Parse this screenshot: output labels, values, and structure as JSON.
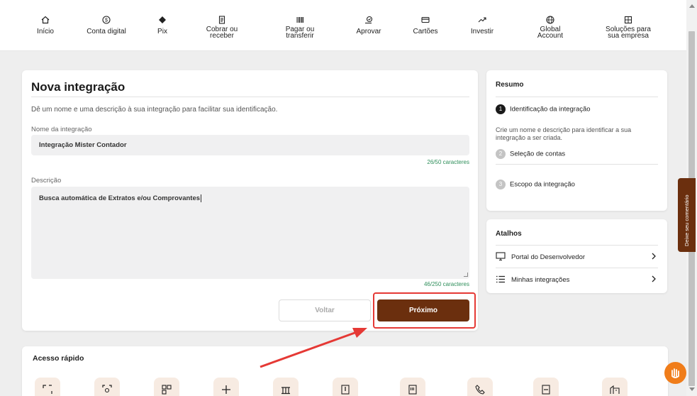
{
  "nav": {
    "items": [
      {
        "label": "Início",
        "icon": "home-icon"
      },
      {
        "label": "Conta digital",
        "icon": "dollar-coin-icon"
      },
      {
        "label": "Pix",
        "icon": "pix-icon"
      },
      {
        "label1": "Cobrar ou",
        "label2": "receber",
        "icon": "invoice-icon"
      },
      {
        "label1": "Pagar ou",
        "label2": "transferir",
        "icon": "barcode-icon"
      },
      {
        "label": "Aprovar",
        "icon": "approve-icon"
      },
      {
        "label": "Cartões",
        "icon": "card-icon"
      },
      {
        "label": "Investir",
        "icon": "trend-icon"
      },
      {
        "label1": "Global",
        "label2": "Account",
        "icon": "globe-icon"
      },
      {
        "label1": "Soluções para",
        "label2": "sua empresa",
        "icon": "building-icon"
      }
    ]
  },
  "main": {
    "title": "Nova integração",
    "subtitle": "Dê um nome e uma descrição à sua integração para facilitar sua identificação.",
    "name_label": "Nome da integração",
    "name_value": "Integração Mister Contador",
    "name_counter": "26/50 caracteres",
    "desc_label": "Descrição",
    "desc_value": "Busca automática de Extratos e/ou Comprovantes",
    "desc_counter": "46/250 caracteres",
    "back_label": "Voltar",
    "next_label": "Próximo"
  },
  "resumo": {
    "title": "Resumo",
    "steps": [
      {
        "num": "1",
        "label": "Identificação da integração"
      },
      {
        "num": "2",
        "label": "Seleção de contas"
      },
      {
        "num": "3",
        "label": "Escopo da integração"
      }
    ],
    "step1_desc": "Crie um nome e descrição para identificar a sua integração a ser criada."
  },
  "atalhos": {
    "title": "Atalhos",
    "items": [
      {
        "label": "Portal do Desenvolvedor",
        "icon": "monitor-icon"
      },
      {
        "label": "Minhas integrações",
        "icon": "list-icon"
      }
    ]
  },
  "quick": {
    "title": "Acesso rápido"
  },
  "feedback": {
    "label": "Deixe seu comentário"
  },
  "colors": {
    "brand": "#6b2f0e",
    "highlight": "#e53935",
    "counter": "#2f8f5b",
    "chat": "#f07d1a"
  }
}
